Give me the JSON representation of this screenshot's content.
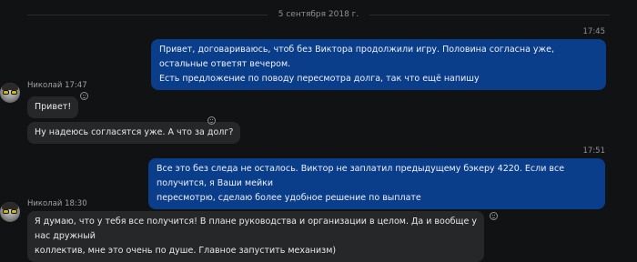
{
  "date_separator": "5 сентября 2018 г.",
  "messages": [
    {
      "time": "17:45",
      "lines": [
        "Привет, договариваюсь, чтоб без Виктора продолжили игру. Половина согласна уже, остальные ответят вечером.",
        "Есть предложение по поводу пересмотра долга, так что ещё напишу"
      ]
    },
    {
      "sender": "Николай 17:47",
      "bubbles": [
        "Привет!",
        "Ну надеюсь согласятся уже. А что за долг?"
      ],
      "avatar": "avatar-nikolai"
    },
    {
      "time": "17:51",
      "lines": [
        "Все это без следа не осталось. Виктор не заплатил предыдущему бэкеру 4220. Если все получится, я Ваши мейки",
        "пересмотрю, сделаю более удобное решение по выплате"
      ]
    },
    {
      "sender": "Николай 18:30",
      "lines": [
        "Я думаю, что у тебя все получится! В плане руководства и организации в целом. Да и вообще у нас дружный",
        "коллектив, мне это очень по душе. Главное запустить механизм)"
      ],
      "avatar": "avatar-nikolai"
    }
  ],
  "icons": {
    "reaction": "emoji-smile-icon"
  },
  "colors": {
    "background": "#111213",
    "outgoing": "#0a3d8a",
    "incoming": "#262728"
  }
}
